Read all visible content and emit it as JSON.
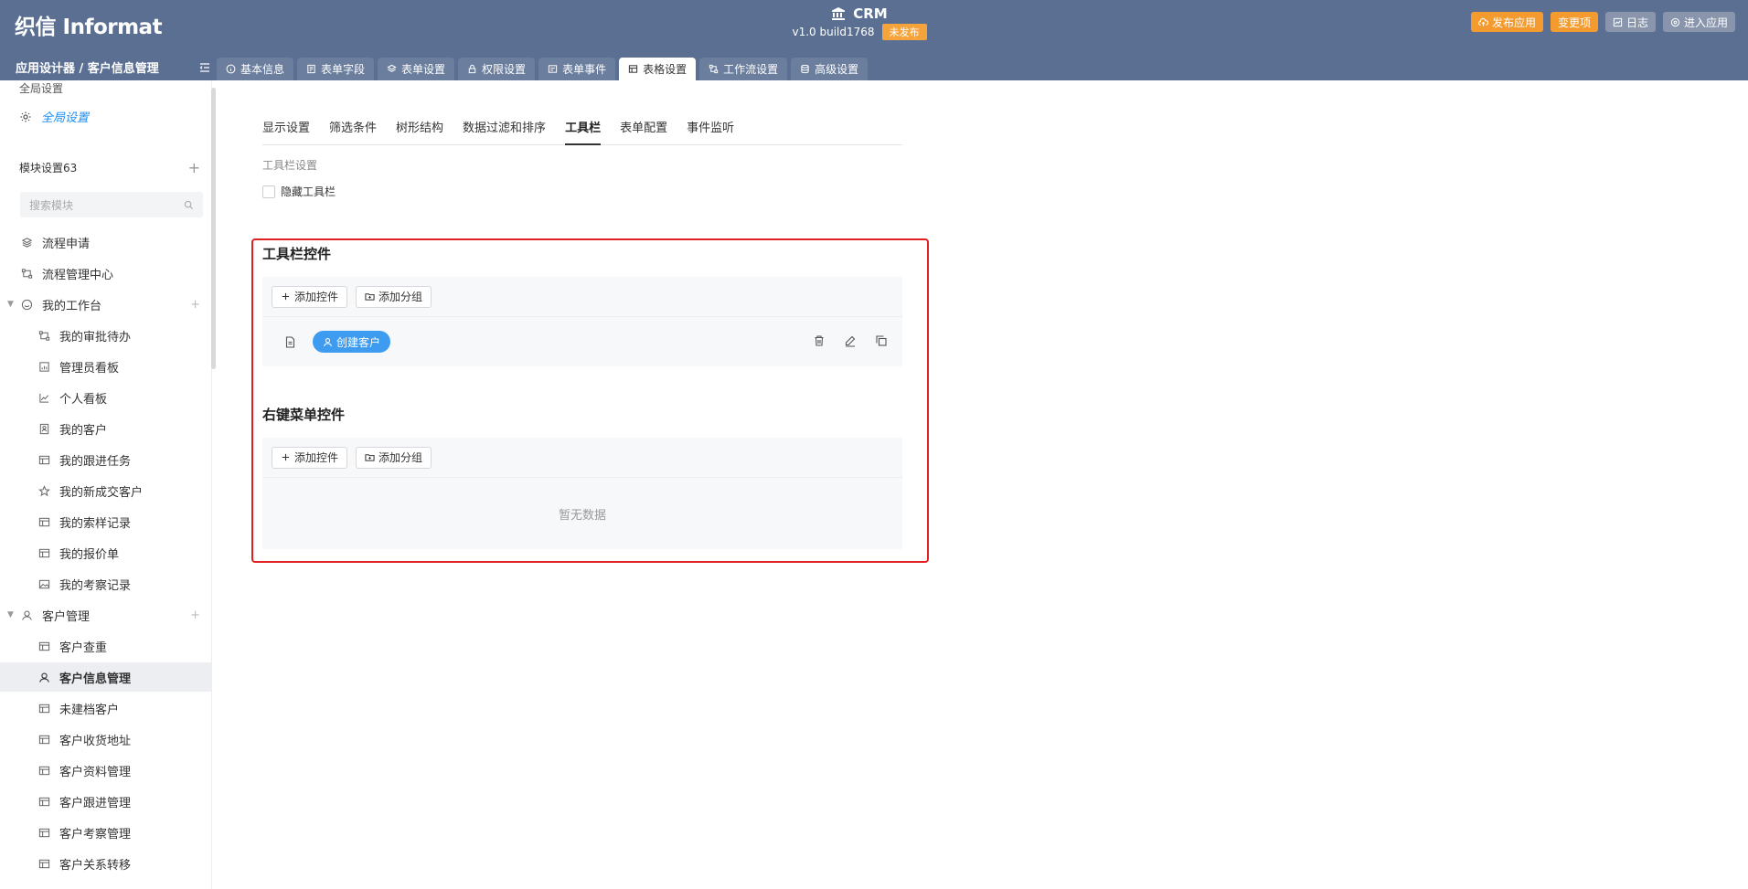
{
  "header": {
    "logo": "织信 Informat",
    "app_name": "CRM",
    "version": "v1.0 build1768",
    "status_badge": "未发布",
    "actions": {
      "publish": "发布应用",
      "changes": "变更项",
      "log": "日志",
      "enter": "进入应用"
    },
    "breadcrumb": "应用设计器 / 客户信息管理",
    "tabs": [
      "基本信息",
      "表单字段",
      "表单设置",
      "权限设置",
      "表单事件",
      "表格设置",
      "工作流设置",
      "高级设置"
    ],
    "active_tab": "表格设置"
  },
  "sidebar": {
    "cut_text": "全局设置",
    "global_settings": "全局设置",
    "module_label": "模块设置63",
    "search_placeholder": "搜索模块",
    "items": [
      {
        "label": "流程申请",
        "icon": "layers-icon"
      },
      {
        "label": "流程管理中心",
        "icon": "flow-icon"
      },
      {
        "label": "我的工作台",
        "icon": "smile-icon"
      },
      {
        "label": "我的审批待办",
        "icon": "flow-icon"
      },
      {
        "label": "管理员看板",
        "icon": "dashboard-icon"
      },
      {
        "label": "个人看板",
        "icon": "line-chart-icon"
      },
      {
        "label": "我的客户",
        "icon": "contact-icon"
      },
      {
        "label": "我的跟进任务",
        "icon": "table-icon"
      },
      {
        "label": "我的新成交客户",
        "icon": "star-icon"
      },
      {
        "label": "我的索样记录",
        "icon": "table-icon"
      },
      {
        "label": "我的报价单",
        "icon": "table-icon"
      },
      {
        "label": "我的考察记录",
        "icon": "image-icon"
      },
      {
        "label": "客户管理",
        "icon": "user-icon"
      },
      {
        "label": "客户查重",
        "icon": "table-icon"
      },
      {
        "label": "客户信息管理",
        "icon": "user-icon"
      },
      {
        "label": "未建档客户",
        "icon": "table-icon"
      },
      {
        "label": "客户收货地址",
        "icon": "table-icon"
      },
      {
        "label": "客户资料管理",
        "icon": "table-icon"
      },
      {
        "label": "客户跟进管理",
        "icon": "table-icon"
      },
      {
        "label": "客户考察管理",
        "icon": "table-icon"
      },
      {
        "label": "客户关系转移",
        "icon": "table-icon"
      }
    ]
  },
  "main": {
    "subtabs": [
      "显示设置",
      "筛选条件",
      "树形结构",
      "数据过滤和排序",
      "工具栏",
      "表单配置",
      "事件监听"
    ],
    "active_subtab": "工具栏",
    "toolbar_settings_label": "工具栏设置",
    "hide_toolbar_label": "隐藏工具栏",
    "toolbar_controls_title": "工具栏控件",
    "add_control": "添加控件",
    "add_group": "添加分组",
    "create_customer": "创建客户",
    "context_menu_title": "右键菜单控件",
    "empty_text": "暂无数据"
  }
}
